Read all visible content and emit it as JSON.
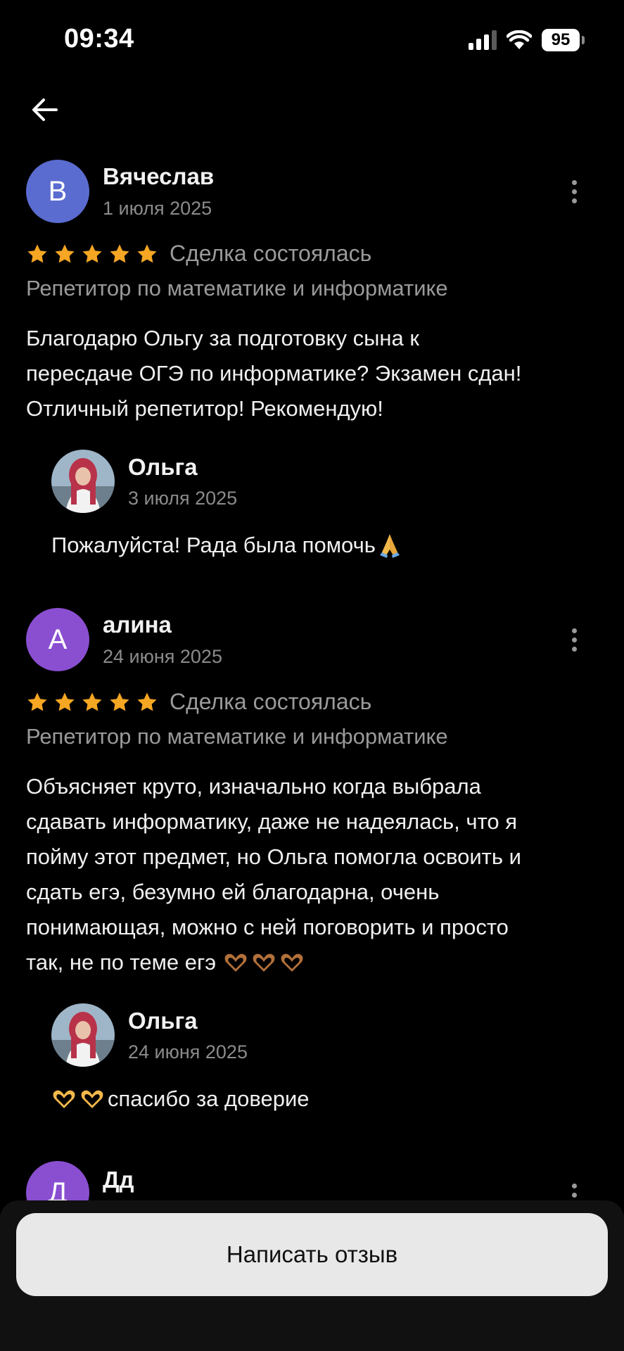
{
  "status_bar": {
    "time": "09:34",
    "battery": "95"
  },
  "stars_color": "#F5A623",
  "reviews": [
    {
      "avatar_letter": "В",
      "avatar_color": "#5B6CD1",
      "author": "Вячеслав",
      "date": "1 июля 2025",
      "rating": 5,
      "deal_status": "Сделка состоялась",
      "category": "Репетитор по математике и информатике",
      "text_lines": [
        "Благодарю Ольгу за подготовку сына к",
        "пересдаче ОГЭ по информатике? Экзамен сдан!",
        "Отличный репетитор! Рекомендую!"
      ],
      "reply": {
        "author": "Ольга",
        "date": "3 июля 2025",
        "text": "Пожалуйста! Рада была помочь",
        "emoji": "folded-hands-emoji"
      }
    },
    {
      "avatar_letter": "А",
      "avatar_color": "#8A4FD1",
      "author": "алина",
      "date": "24 июня 2025",
      "rating": 5,
      "deal_status": "Сделка состоялась",
      "category": "Репетитор по математике и информатике",
      "text_lines": [
        "Объясняет круто, изначально когда выбрала",
        "сдавать информатику, даже не надеялась, что я",
        "пойму этот предмет, но Ольга помогла освоить и",
        "сдать егэ, безумно ей благодарна, очень",
        "понимающая, можно с ней поговорить и просто",
        "так, не по теме егэ"
      ],
      "reply": {
        "author": "Ольга",
        "date": "24 июня 2025",
        "text": "спасибо за доверие",
        "emoji": "heart-hands-emoji"
      }
    },
    {
      "avatar_letter": "Д",
      "avatar_color": "#8A4FD1",
      "author": "Дд"
    }
  ],
  "write_review_button": "Написать отзыв"
}
